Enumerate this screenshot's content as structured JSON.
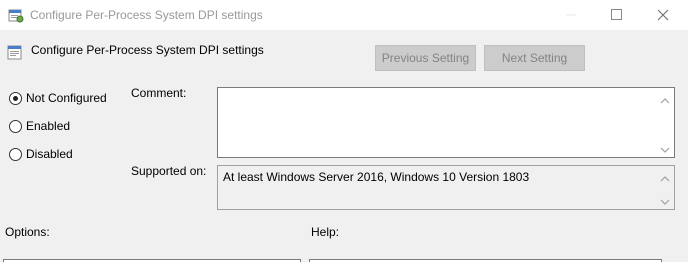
{
  "window": {
    "title": "Configure Per-Process System DPI settings"
  },
  "header": {
    "title": "Configure Per-Process System DPI settings",
    "prev_label": "Previous Setting",
    "next_label": "Next Setting"
  },
  "state": {
    "options": [
      {
        "label": "Not Configured",
        "selected": true
      },
      {
        "label": "Enabled",
        "selected": false
      },
      {
        "label": "Disabled",
        "selected": false
      }
    ]
  },
  "comment": {
    "label": "Comment:",
    "value": ""
  },
  "supported": {
    "label": "Supported on:",
    "value": "At least Windows Server 2016, Windows 10 Version 1803"
  },
  "sections": {
    "options_label": "Options:",
    "help_label": "Help:"
  },
  "icons": {
    "app": "policy-settings-icon",
    "minimize": "minimize-icon",
    "maximize": "maximize-icon",
    "close": "close-icon"
  }
}
